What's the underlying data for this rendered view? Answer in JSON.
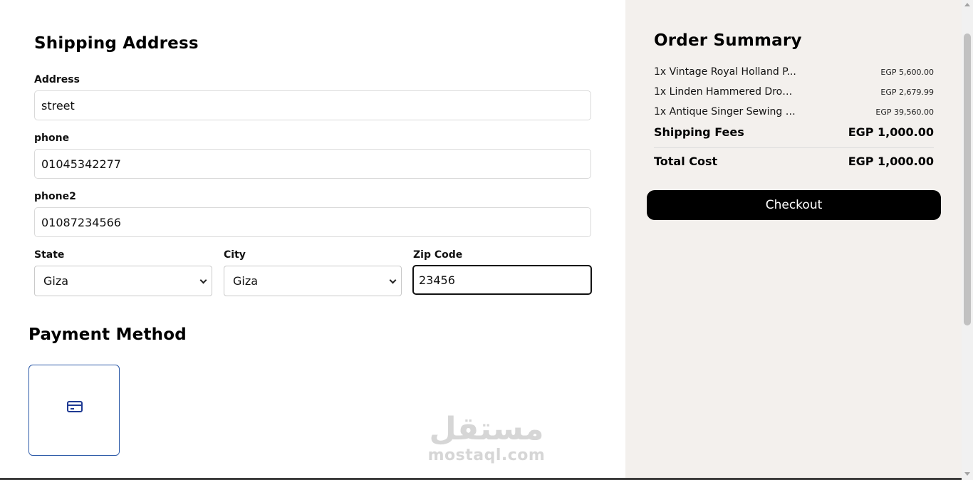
{
  "shipping": {
    "title": "Shipping Address",
    "address": {
      "label": "Address",
      "value": "street"
    },
    "phone": {
      "label": "phone",
      "value": "01045342277"
    },
    "phone2": {
      "label": "phone2",
      "value": "01087234566"
    },
    "state": {
      "label": "State",
      "value": "Giza"
    },
    "city": {
      "label": "City",
      "value": "Giza"
    },
    "zip": {
      "label": "Zip Code",
      "value": "23456"
    }
  },
  "payment": {
    "title": "Payment Method",
    "options": [
      {
        "icon": "credit-card-icon",
        "selected": true
      }
    ]
  },
  "summary": {
    "title": "Order Summary",
    "items": [
      {
        "name": "1x Vintage Royal Holland P...",
        "price": "EGP 5,600.00"
      },
      {
        "name": "1x Linden Hammered Drop ...",
        "price": "EGP 2,679.99"
      },
      {
        "name": "1x Antique Singer Sewing M...",
        "price": "EGP 39,560.00"
      }
    ],
    "shipping_fees_label": "Shipping Fees",
    "shipping_fees_value": "EGP 1,000.00",
    "total_label": "Total Cost",
    "total_value": "EGP 1,000.00",
    "checkout_label": "Checkout"
  },
  "watermark": {
    "arabic": "مستقل",
    "latin": "mostaql.com"
  },
  "colors": {
    "panel": "#f3f0ed",
    "accent": "#1f3a93",
    "button": "#000000"
  }
}
